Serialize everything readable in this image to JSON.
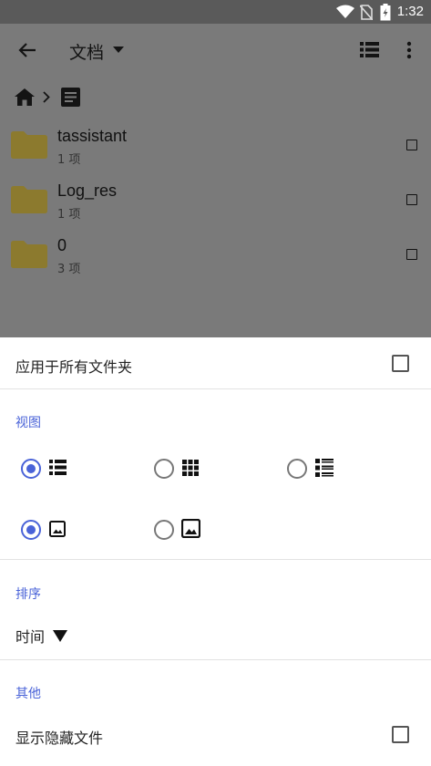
{
  "status_bar": {
    "time": "1:32",
    "icons": [
      "wifi-icon",
      "no-sim-icon",
      "battery-charging-icon"
    ]
  },
  "app_bar": {
    "title": "文档",
    "icons": [
      "back-arrow-icon",
      "dropdown-icon",
      "list-view-icon",
      "more-vert-icon"
    ]
  },
  "breadcrumb": {
    "icons": [
      "home-icon",
      "chevron-right-icon",
      "document-icon"
    ]
  },
  "files": [
    {
      "name": "tassistant",
      "count": "1 项"
    },
    {
      "name": "Log_res",
      "count": "1 项"
    },
    {
      "name": "0",
      "count": "3 项"
    }
  ],
  "sheet": {
    "apply_all_label": "应用于所有文件夹",
    "view_section": "视图",
    "view_options_row1": [
      {
        "icon": "list-icon",
        "selected": true
      },
      {
        "icon": "grid-icon",
        "selected": false
      },
      {
        "icon": "detailed-list-icon",
        "selected": false
      }
    ],
    "view_options_row2": [
      {
        "icon": "small-thumbnail-icon",
        "selected": true
      },
      {
        "icon": "large-thumbnail-icon",
        "selected": false
      }
    ],
    "sort_section": "排序",
    "sort_value": "时间",
    "other_section": "其他",
    "show_hidden_label": "显示隐藏文件"
  },
  "colors": {
    "accent": "#4a63d8",
    "folder": "#8c7a2e",
    "scrim": "#7a7a7a"
  }
}
